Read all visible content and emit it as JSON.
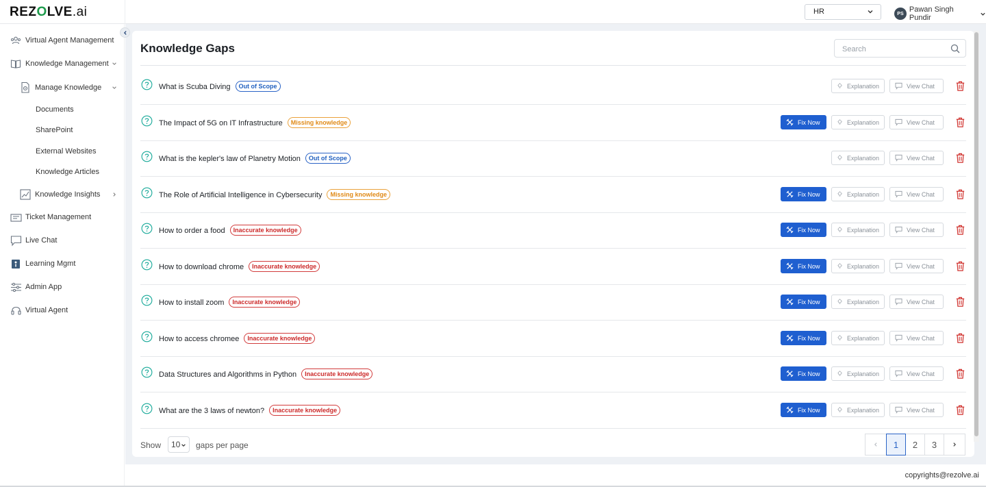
{
  "brand": {
    "logo_text_1": "REZ",
    "logo_text_o": "O",
    "logo_text_2": "LVE",
    "logo_text_ai": ".ai"
  },
  "header": {
    "workspace_value": "HR",
    "user": {
      "initials": "PS",
      "name": "Pawan Singh Pundir"
    }
  },
  "sidebar": {
    "items": [
      {
        "label": "Virtual Agent Management",
        "icon": "users-icon"
      },
      {
        "label": "Knowledge Management",
        "icon": "book-icon"
      },
      {
        "label": "Manage Knowledge",
        "icon": "document-gear-icon"
      },
      {
        "label": "Knowledge Insights",
        "icon": "chart-icon"
      },
      {
        "label": "Ticket Management",
        "icon": "ticket-icon"
      },
      {
        "label": "Live Chat",
        "icon": "chat-icon"
      },
      {
        "label": "Learning Mgmt",
        "icon": "learning-icon"
      },
      {
        "label": "Admin App",
        "icon": "sliders-icon"
      },
      {
        "label": "Virtual Agent",
        "icon": "headset-icon"
      }
    ],
    "sub_items": [
      "Documents",
      "SharePoint",
      "External Websites",
      "Knowledge Articles"
    ]
  },
  "page": {
    "title": "Knowledge Gaps",
    "search_placeholder": "Search"
  },
  "actions": {
    "fix_now": "Fix Now",
    "explanation": "Explanation",
    "view_chat": "View Chat"
  },
  "gaps": [
    {
      "title": "What is Scuba Diving",
      "badge": "Out of Scope",
      "type": "scope",
      "fixable": false
    },
    {
      "title": "The Impact of 5G on IT Infrastructure",
      "badge": "Missing knowledge",
      "type": "missing",
      "fixable": true
    },
    {
      "title": "What is the kepler's law of Planetry Motion",
      "badge": "Out of Scope",
      "type": "scope",
      "fixable": false
    },
    {
      "title": "The Role of Artificial Intelligence in Cybersecurity",
      "badge": "Missing knowledge",
      "type": "missing",
      "fixable": true
    },
    {
      "title": "How to order a food",
      "badge": "Inaccurate knowledge",
      "type": "inacc",
      "fixable": true
    },
    {
      "title": "How to download chrome",
      "badge": "Inaccurate knowledge",
      "type": "inacc",
      "fixable": true
    },
    {
      "title": "How to install zoom",
      "badge": "Inaccurate knowledge",
      "type": "inacc",
      "fixable": true
    },
    {
      "title": "How to access chromee",
      "badge": "Inaccurate knowledge",
      "type": "inacc",
      "fixable": true
    },
    {
      "title": "Data Structures and Algorithms in Python",
      "badge": "Inaccurate knowledge",
      "type": "inacc",
      "fixable": true
    },
    {
      "title": "What are the 3 laws of newton?",
      "badge": "Inaccurate knowledge",
      "type": "inacc",
      "fixable": true
    }
  ],
  "pagination": {
    "show_label": "Show",
    "per_page_value": "10",
    "per_page_suffix": "gaps per page",
    "pages": [
      "1",
      "2",
      "3"
    ],
    "current_page": "1"
  },
  "footer": {
    "copyright": "copyrights@rezolve.ai"
  },
  "colors": {
    "primary": "#1f5fd0",
    "scope": "#1f5fbf",
    "missing": "#e08a17",
    "inaccurate": "#cc2a2a",
    "delete": "#d0312d",
    "question": "#18a999"
  }
}
